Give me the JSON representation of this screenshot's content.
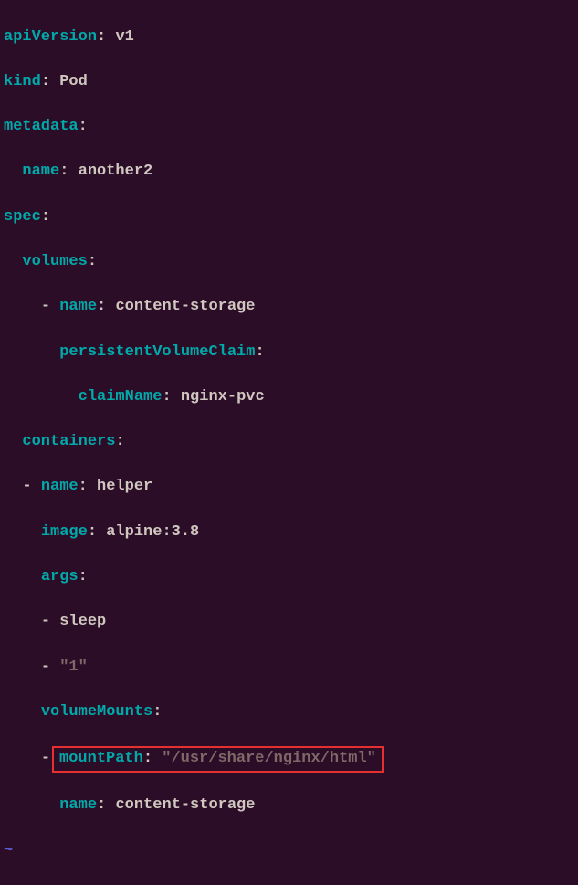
{
  "yaml": {
    "l1_key": "apiVersion",
    "l1_val": "v1",
    "l2_key": "kind",
    "l2_val": "Pod",
    "l3_key": "metadata",
    "l4_key": "name",
    "l4_val": "another2",
    "l5_key": "spec",
    "l6_key": "volumes",
    "l7_key": "name",
    "l7_val": "content-storage",
    "l8_key": "persistentVolumeClaim",
    "l9_key": "claimName",
    "l9_val": "nginx-pvc",
    "l10_key": "containers",
    "l11_key": "name",
    "l11_val": "helper",
    "l12_key": "image",
    "l12_val": "alpine:3.8",
    "l13_key": "args",
    "l14_val": "sleep",
    "l15_val": "\"1\"",
    "l16_key": "volumeMounts",
    "l17_key": "mountPath",
    "l17_val": "\"/usr/share/nginx/html\"",
    "l18_key": "name",
    "l18_val": "content-storage",
    "tilde": "~"
  },
  "highlight_line": 17
}
